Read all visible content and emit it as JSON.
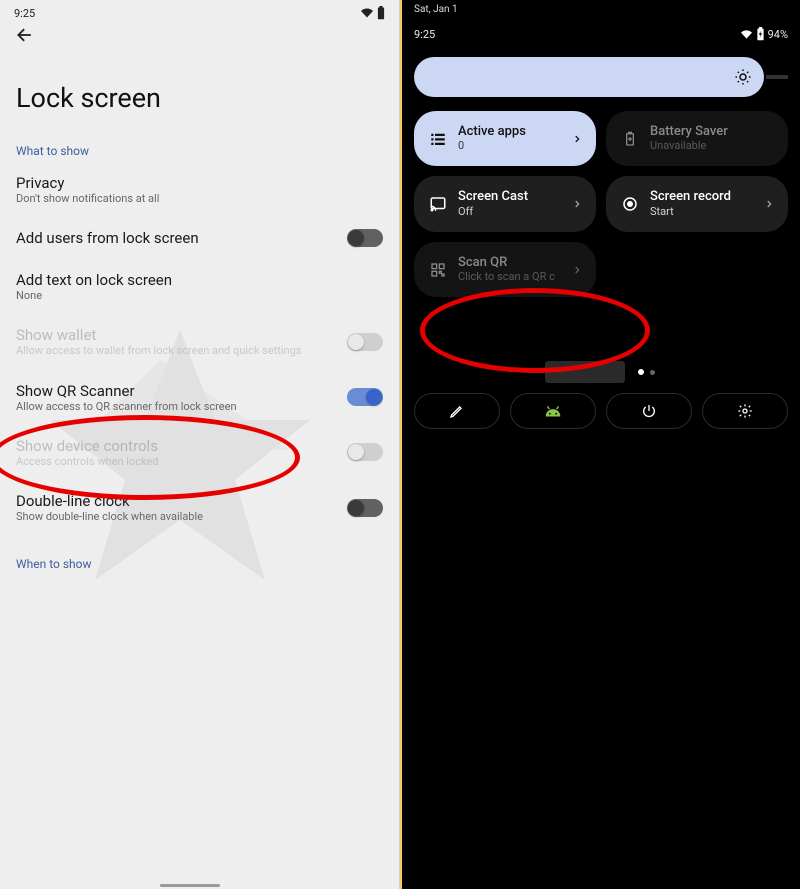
{
  "left": {
    "status_time": "9:25",
    "page_title": "Lock screen",
    "section_what": "What to show",
    "section_when": "When to show",
    "items": {
      "privacy": {
        "title": "Privacy",
        "sub": "Don't show notifications at all"
      },
      "add_users": {
        "title": "Add users from lock screen"
      },
      "add_text": {
        "title": "Add text on lock screen",
        "sub": "None"
      },
      "wallet": {
        "title": "Show wallet",
        "sub": "Allow access to wallet from lock screen and quick settings"
      },
      "qr": {
        "title": "Show QR Scanner",
        "sub": "Allow access to QR scanner from lock screen"
      },
      "controls": {
        "title": "Show device controls",
        "sub": "Access controls when locked"
      },
      "clock": {
        "title": "Double-line clock",
        "sub": "Show double-line clock when available"
      }
    }
  },
  "right": {
    "date": "Sat, Jan 1",
    "time": "9:25",
    "battery_text": "94%",
    "tiles": {
      "active": {
        "title": "Active apps",
        "sub": "0"
      },
      "saver": {
        "title": "Battery Saver",
        "sub": "Unavailable"
      },
      "cast": {
        "title": "Screen Cast",
        "sub": "Off"
      },
      "record": {
        "title": "Screen record",
        "sub": "Start"
      },
      "qr": {
        "title": "Scan QR",
        "sub": "Click to scan a QR c"
      }
    }
  }
}
